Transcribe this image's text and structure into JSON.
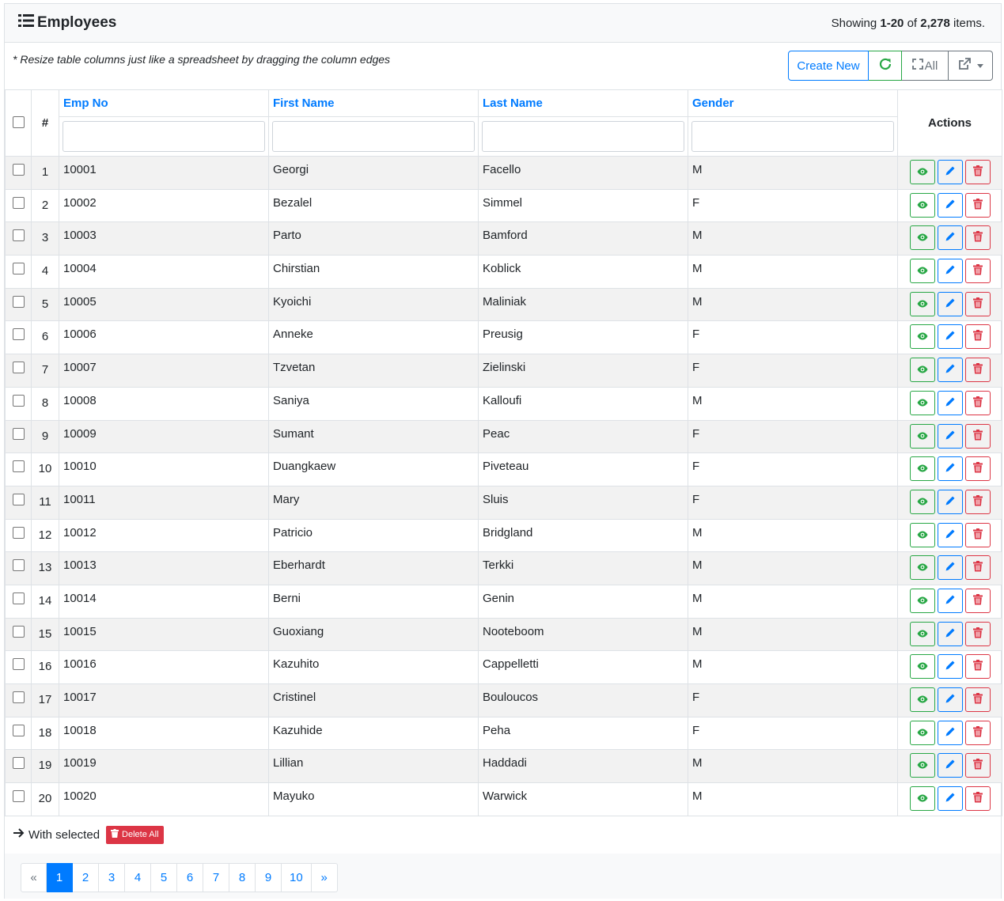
{
  "header": {
    "title": "Employees",
    "summary_prefix": "Showing ",
    "summary_range": "1-20",
    "summary_of": " of ",
    "summary_total": "2,278",
    "summary_suffix": " items."
  },
  "toolbar": {
    "note": "* Resize table columns just like a spreadsheet by dragging the column edges",
    "create_label": "Create New",
    "all_label": "All"
  },
  "table": {
    "columns": {
      "hash": "#",
      "emp_no": "Emp No",
      "first_name": "First Name",
      "last_name": "Last Name",
      "gender": "Gender",
      "actions": "Actions"
    },
    "rows": [
      {
        "n": "1",
        "emp_no": "10001",
        "first": "Georgi",
        "last": "Facello",
        "gender": "M"
      },
      {
        "n": "2",
        "emp_no": "10002",
        "first": "Bezalel",
        "last": "Simmel",
        "gender": "F"
      },
      {
        "n": "3",
        "emp_no": "10003",
        "first": "Parto",
        "last": "Bamford",
        "gender": "M"
      },
      {
        "n": "4",
        "emp_no": "10004",
        "first": "Chirstian",
        "last": "Koblick",
        "gender": "M"
      },
      {
        "n": "5",
        "emp_no": "10005",
        "first": "Kyoichi",
        "last": "Maliniak",
        "gender": "M"
      },
      {
        "n": "6",
        "emp_no": "10006",
        "first": "Anneke",
        "last": "Preusig",
        "gender": "F"
      },
      {
        "n": "7",
        "emp_no": "10007",
        "first": "Tzvetan",
        "last": "Zielinski",
        "gender": "F"
      },
      {
        "n": "8",
        "emp_no": "10008",
        "first": "Saniya",
        "last": "Kalloufi",
        "gender": "M"
      },
      {
        "n": "9",
        "emp_no": "10009",
        "first": "Sumant",
        "last": "Peac",
        "gender": "F"
      },
      {
        "n": "10",
        "emp_no": "10010",
        "first": "Duangkaew",
        "last": "Piveteau",
        "gender": "F"
      },
      {
        "n": "11",
        "emp_no": "10011",
        "first": "Mary",
        "last": "Sluis",
        "gender": "F"
      },
      {
        "n": "12",
        "emp_no": "10012",
        "first": "Patricio",
        "last": "Bridgland",
        "gender": "M"
      },
      {
        "n": "13",
        "emp_no": "10013",
        "first": "Eberhardt",
        "last": "Terkki",
        "gender": "M"
      },
      {
        "n": "14",
        "emp_no": "10014",
        "first": "Berni",
        "last": "Genin",
        "gender": "M"
      },
      {
        "n": "15",
        "emp_no": "10015",
        "first": "Guoxiang",
        "last": "Nooteboom",
        "gender": "M"
      },
      {
        "n": "16",
        "emp_no": "10016",
        "first": "Kazuhito",
        "last": "Cappelletti",
        "gender": "M"
      },
      {
        "n": "17",
        "emp_no": "10017",
        "first": "Cristinel",
        "last": "Bouloucos",
        "gender": "F"
      },
      {
        "n": "18",
        "emp_no": "10018",
        "first": "Kazuhide",
        "last": "Peha",
        "gender": "F"
      },
      {
        "n": "19",
        "emp_no": "10019",
        "first": "Lillian",
        "last": "Haddadi",
        "gender": "M"
      },
      {
        "n": "20",
        "emp_no": "10020",
        "first": "Mayuko",
        "last": "Warwick",
        "gender": "M"
      }
    ]
  },
  "footer": {
    "with_selected": "With selected",
    "delete_all": "Delete All"
  },
  "pagination": {
    "prev": "«",
    "next": "»",
    "pages": [
      "1",
      "2",
      "3",
      "4",
      "5",
      "6",
      "7",
      "8",
      "9",
      "10"
    ],
    "active": "1"
  },
  "icons": {
    "title": "list-icon",
    "refresh": "refresh-icon",
    "all": "fullscreen-icon",
    "export": "export-icon",
    "view": "eye-icon",
    "edit": "pencil-icon",
    "delete": "trash-icon",
    "arrow": "arrow-right-icon"
  },
  "colors": {
    "primary": "#007bff",
    "success": "#28a745",
    "danger": "#dc3545",
    "secondary": "#6c757d"
  }
}
